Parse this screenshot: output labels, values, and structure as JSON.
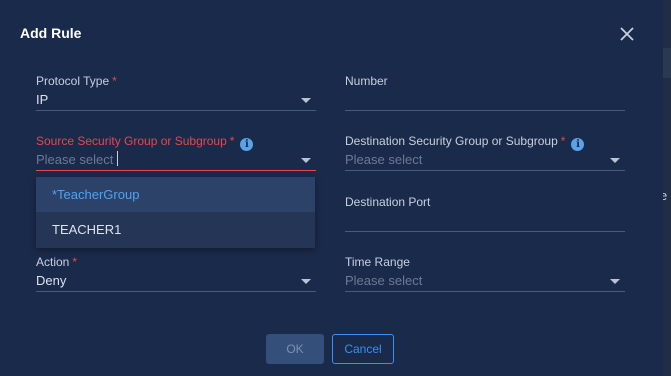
{
  "background": {
    "edge_text": "e"
  },
  "dialog": {
    "title": "Add Rule",
    "close_icon": "close-icon"
  },
  "form": {
    "protocol_type": {
      "label": "Protocol Type",
      "required": "*",
      "value": "IP"
    },
    "number": {
      "label": "Number",
      "value": ""
    },
    "source_group": {
      "label": "Source Security Group or Subgroup",
      "required": "*",
      "info_icon": "info-icon",
      "placeholder": "Please select",
      "state": "error, open",
      "options": [
        "*TeacherGroup",
        "TEACHER1"
      ],
      "highlighted_option": "*TeacherGroup"
    },
    "destination_group": {
      "label": "Destination Security Group or Subgroup",
      "required": "*",
      "info_icon": "info-icon",
      "placeholder": "Please select"
    },
    "destination_port": {
      "label": "Destination Port",
      "value": ""
    },
    "action": {
      "label": "Action",
      "required": "*",
      "value": "Deny"
    },
    "time_range": {
      "label": "Time Range",
      "placeholder": "Please select"
    }
  },
  "buttons": {
    "ok": "OK",
    "cancel": "Cancel"
  },
  "colors": {
    "dialog_bg": "#1a2a4a",
    "accent": "#3c8ff0",
    "error": "#e5484d",
    "highlight_text": "#4ea3f2"
  }
}
